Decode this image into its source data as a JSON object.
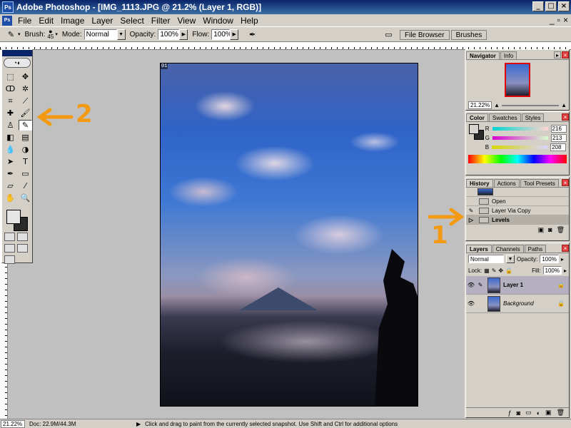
{
  "window": {
    "title": "Adobe Photoshop - [IMG_1113.JPG @ 21.2% (Layer 1, RGB)]"
  },
  "menu": [
    "File",
    "Edit",
    "Image",
    "Layer",
    "Select",
    "Filter",
    "View",
    "Window",
    "Help"
  ],
  "options": {
    "brush_label": "Brush:",
    "brush_size": "45",
    "mode_label": "Mode:",
    "mode_value": "Normal",
    "opacity_label": "Opacity:",
    "opacity_value": "100%",
    "flow_label": "Flow:",
    "flow_value": "100%"
  },
  "well_tabs": [
    "File Browser",
    "Brushes"
  ],
  "image": {
    "corner_label": "01"
  },
  "annotations": {
    "one": "1",
    "two": "2",
    "color": "#f39a12"
  },
  "navigator": {
    "tabs": [
      "Navigator",
      "Info"
    ],
    "zoom": "21.22%"
  },
  "color_panel": {
    "tabs": [
      "Color",
      "Swatches",
      "Styles"
    ],
    "channels": [
      {
        "label": "R",
        "value": "216",
        "gradient": "linear-gradient(90deg,#00d5d0,#ffd5d0)"
      },
      {
        "label": "G",
        "value": "213",
        "gradient": "linear-gradient(90deg,#d800d0,#d8ffd0)"
      },
      {
        "label": "B",
        "value": "208",
        "gradient": "linear-gradient(90deg,#d8d500,#d8d5ff)"
      }
    ]
  },
  "history": {
    "tabs": [
      "History",
      "Actions",
      "Tool Presets"
    ],
    "items": [
      "Open",
      "Layer Via Copy",
      "Levels"
    ]
  },
  "layers": {
    "tabs": [
      "Layers",
      "Channels",
      "Paths"
    ],
    "blend": "Normal",
    "opacity_label": "Opacity:",
    "opacity": "100%",
    "lock_label": "Lock:",
    "fill_label": "Fill:",
    "fill": "100%",
    "items": [
      "Layer 1",
      "Background"
    ]
  },
  "status": {
    "zoom": "21.22%",
    "doc": "Doc: 22.9M/44.3M",
    "hint": "Click and drag to paint from the currently selected snapshot.  Use Shift and Ctrl for additional options"
  }
}
